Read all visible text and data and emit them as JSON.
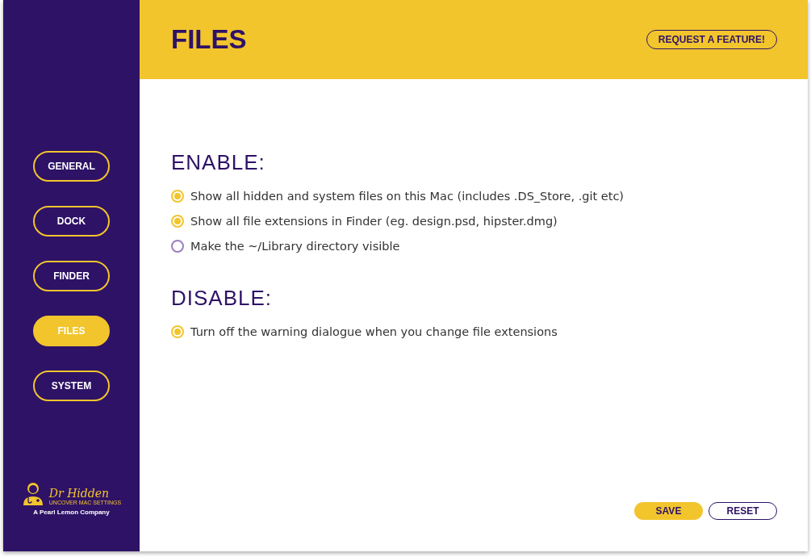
{
  "nav": [
    {
      "label": "GENERAL",
      "selected": false
    },
    {
      "label": "DOCK",
      "selected": false
    },
    {
      "label": "FINDER",
      "selected": false
    },
    {
      "label": "FILES",
      "selected": true
    },
    {
      "label": "SYSTEM",
      "selected": false
    }
  ],
  "logo": {
    "name": "Dr Hidden",
    "tagline": "UNCOVER MAC SETTINGS",
    "company": "A Pearl Lemon Company"
  },
  "header": {
    "title": "FILES",
    "button": "REQUEST A FEATURE!"
  },
  "sections": [
    {
      "title": "ENABLE:",
      "options": [
        {
          "label": "Show all hidden and system files on this Mac (includes .DS_Store, .git etc)",
          "checked": true
        },
        {
          "label": "Show all file extensions in Finder (eg. design.psd, hipster.dmg)",
          "checked": true
        },
        {
          "label": "Make the ~/Library directory visible",
          "checked": false
        }
      ]
    },
    {
      "title": "DISABLE:",
      "options": [
        {
          "label": "Turn off the warning dialogue when you change file extensions",
          "checked": true
        }
      ]
    }
  ],
  "buttons": {
    "save": "SAVE",
    "reset": "RESET"
  }
}
